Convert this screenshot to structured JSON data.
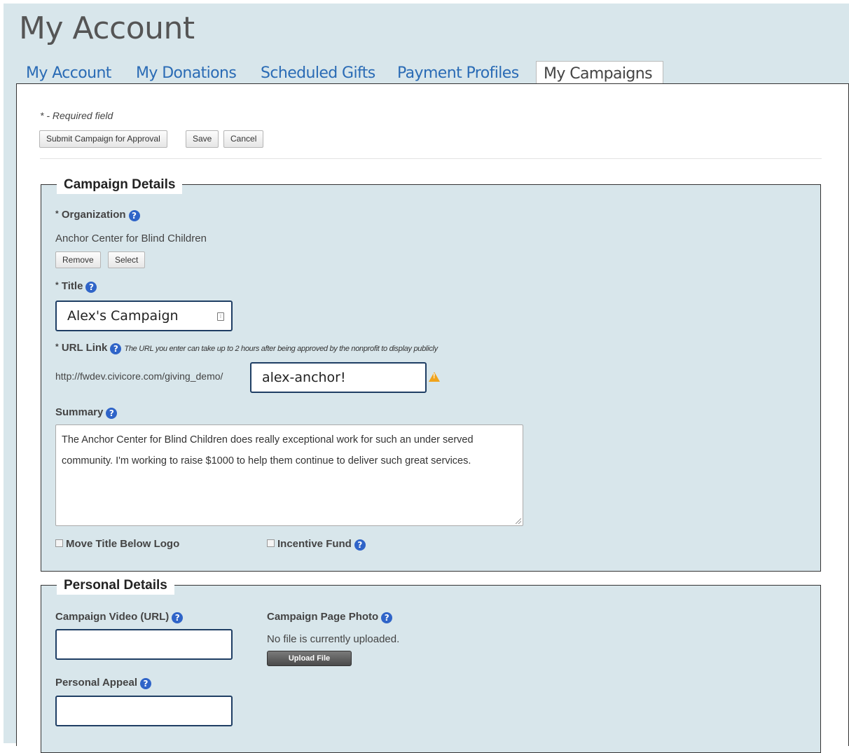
{
  "page": {
    "title": "My Account"
  },
  "tabs": [
    {
      "label": "My Account"
    },
    {
      "label": "My Donations"
    },
    {
      "label": "Scheduled Gifts"
    },
    {
      "label": "Payment Profiles"
    },
    {
      "label": "My Campaigns",
      "active": true
    }
  ],
  "form": {
    "required_note": "* - Required field",
    "buttons": {
      "submit": "Submit Campaign for Approval",
      "save": "Save",
      "cancel": "Cancel"
    }
  },
  "campaign_details": {
    "legend": "Campaign Details",
    "organization": {
      "label": "Organization",
      "value": "Anchor Center for Blind Children",
      "remove": "Remove",
      "select": "Select"
    },
    "title": {
      "label": "Title",
      "value": "Alex's Campaign"
    },
    "url": {
      "label": "URL Link",
      "hint": "The URL you enter can take up to 2 hours after being approved by the nonprofit to display publicly",
      "prefix": "http://fwdev.civicore.com/giving_demo/",
      "value": "alex-anchor!"
    },
    "summary": {
      "label": "Summary",
      "value": "The Anchor Center for Blind Children does really exceptional work for such an under served community. I'm working to raise $1000 to help them continue to deliver such great services."
    },
    "move_title": {
      "label": "Move Title Below Logo",
      "checked": false
    },
    "incentive_fund": {
      "label": "Incentive Fund",
      "checked": false
    }
  },
  "personal_details": {
    "legend": "Personal Details",
    "video": {
      "label": "Campaign Video (URL)",
      "value": ""
    },
    "photo": {
      "label": "Campaign Page Photo",
      "status": "No file is currently uploaded.",
      "upload": "Upload File"
    },
    "appeal": {
      "label": "Personal Appeal",
      "value": ""
    }
  },
  "icons": {
    "help": "question-circle-icon",
    "warning": "warning-triangle-icon",
    "field": "field-indicator-icon"
  },
  "colors": {
    "background": "#d8e6eb",
    "tab_link": "#2a6bb5",
    "help_icon": "#2f64c8",
    "warning": "#f0a31b",
    "input_border": "#1f3e64"
  }
}
